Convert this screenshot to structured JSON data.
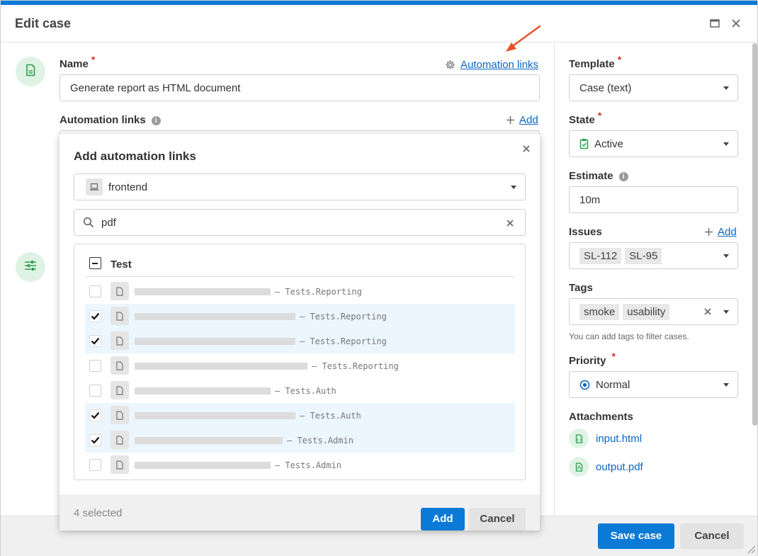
{
  "dialog": {
    "title": "Edit case",
    "save_label": "Save case",
    "cancel_label": "Cancel"
  },
  "left": {
    "name_label": "Name",
    "name_required": "*",
    "automation_links_top_link": "Automation links",
    "name_value": "Generate report as HTML document",
    "automation_links_label": "Automation links",
    "add_label": "Add"
  },
  "popup": {
    "title": "Add automation links",
    "source_value": "frontend",
    "search_value": "pdf",
    "header_label": "Test",
    "rows": [
      {
        "class": "– Tests.Reporting",
        "checked": false
      },
      {
        "class": "– Tests.Reporting",
        "checked": true
      },
      {
        "class": "– Tests.Reporting",
        "checked": true
      },
      {
        "class": "– Tests.Reporting",
        "checked": false
      },
      {
        "class": "– Tests.Auth",
        "checked": false
      },
      {
        "class": "– Tests.Auth",
        "checked": true
      },
      {
        "class": "– Tests.Admin",
        "checked": true
      },
      {
        "class": "– Tests.Admin",
        "checked": false
      }
    ],
    "selected_count": "4 selected",
    "add_label": "Add",
    "cancel_label": "Cancel"
  },
  "right": {
    "template_label": "Template",
    "template_value": "Case (text)",
    "state_label": "State",
    "state_value": "Active",
    "estimate_label": "Estimate",
    "estimate_value": "10m",
    "issues_label": "Issues",
    "issues_add": "Add",
    "issues": [
      "SL-112",
      "SL-95"
    ],
    "tags_label": "Tags",
    "tags": [
      "smoke",
      "usability"
    ],
    "tags_hint": "You can add tags to filter cases.",
    "priority_label": "Priority",
    "priority_value": "Normal",
    "attachments_label": "Attachments",
    "attachments": [
      "input.html",
      "output.pdf"
    ],
    "required_mark": "*"
  },
  "colors": {
    "accent": "#0a7ad6",
    "link": "#0a66c2",
    "required": "#d93025",
    "success_icon": "#2e9e4f",
    "selected_row": "#ebf6fe",
    "arrow": "#e8502a"
  },
  "icons": [
    "file-icon",
    "sliders-icon",
    "gear-icon",
    "plus-icon",
    "info-icon",
    "close-icon",
    "maximize-icon",
    "laptop-icon",
    "search-icon",
    "clipboard-check-icon",
    "radio-dot-icon",
    "checkmark-icon",
    "arrow-annotation-icon",
    "resize-grip-icon"
  ]
}
